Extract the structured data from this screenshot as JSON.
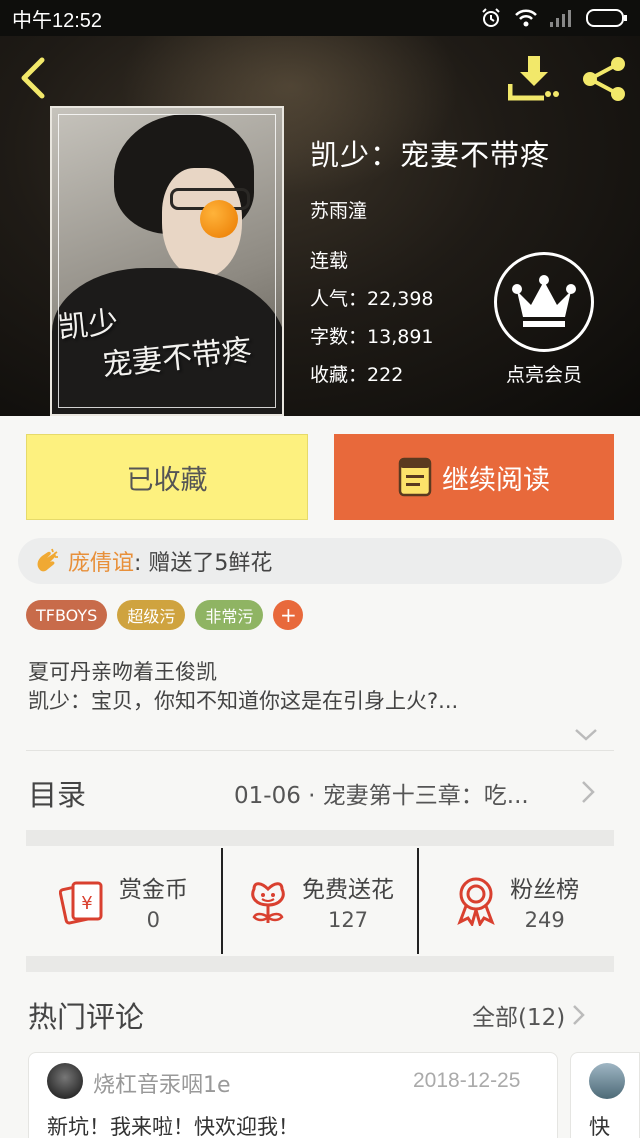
{
  "status_bar": {
    "time": "中午12:52"
  },
  "header": {
    "cover_text": [
      "凯少",
      "宠妻不带疼"
    ]
  },
  "book": {
    "title": "凯少：宠妻不带疼",
    "author": "苏雨潼",
    "status": "连载",
    "popularity_label": "人气：",
    "popularity": "22,398",
    "word_count_label": "字数：",
    "word_count": "13,891",
    "favorites_label": "收藏：",
    "favorites": "222"
  },
  "vip": {
    "label": "点亮会员"
  },
  "actions": {
    "collected_label": "已收藏",
    "read_label": "继续阅读",
    "read_color": "#e8693b",
    "collected_color": "#fdf17f"
  },
  "gift": {
    "user": "庞倩谊",
    "text": ": 赠送了5鲜花"
  },
  "tags": [
    {
      "label": "TFBOYS",
      "color": "#c86b4a"
    },
    {
      "label": "超级污",
      "color": "#cfa33f"
    },
    {
      "label": "非常污",
      "color": "#8fb463"
    }
  ],
  "tag_add": "+",
  "synopsis": [
    "夏可丹亲吻着王俊凯",
    "凯少：宝贝，你知不知道你这是在引身上火?..."
  ],
  "toc": {
    "label": "目录",
    "chapter": "01-06 · 宠妻第十三章：吃..."
  },
  "stats": [
    {
      "label": "赏金币",
      "count": "0",
      "icon": "red-envelope-icon"
    },
    {
      "label": "免费送花",
      "count": "127",
      "icon": "flower-icon"
    },
    {
      "label": "粉丝榜",
      "count": "249",
      "icon": "medal-icon"
    }
  ],
  "comments": {
    "title": "热门评论",
    "all_label": "全部(12)",
    "items": [
      {
        "user": "烧杠音汞咽1e",
        "date": "2018-12-25",
        "text": "新坑！我来啦！快欢迎我！"
      },
      {
        "text": "快"
      }
    ]
  }
}
